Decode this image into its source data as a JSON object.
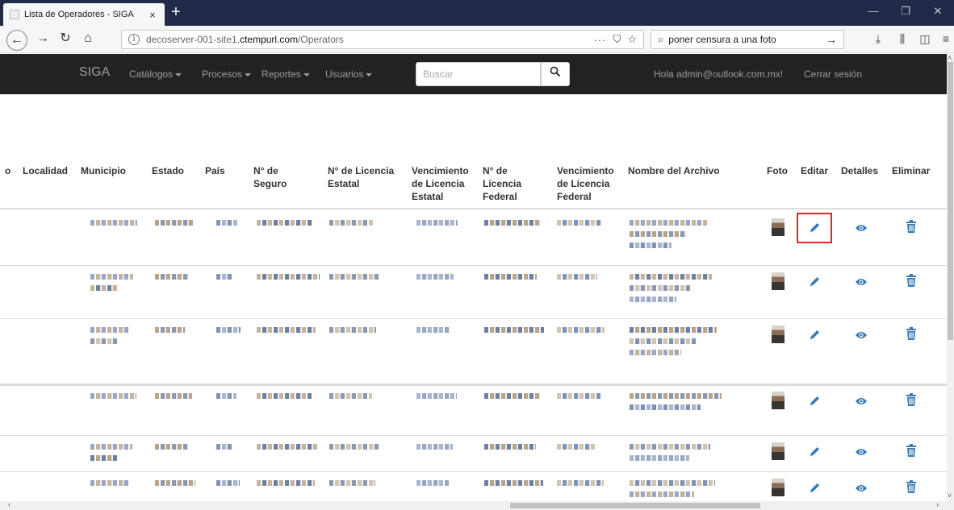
{
  "browser": {
    "tab_title": "Lista de Operadores - SIGA",
    "tab_close": "×",
    "new_tab": "+",
    "url_domain": "decoserver-001-site1.",
    "url_bold": "ctempurl.com",
    "url_path": "/Operators",
    "url_menu": "···",
    "search_query": "poner censura a una foto",
    "search_go": "→"
  },
  "site": {
    "brand": "SIGA",
    "menus": [
      "Catálogos",
      "Procesos",
      "Reportes",
      "Usuarios"
    ],
    "search_placeholder": "Buscar",
    "greeting": "Hola admin@outlook.com.mx!",
    "logout": "Cerrar sesión"
  },
  "table": {
    "headers": [
      "o",
      "Localidad",
      "Municipio",
      "Estado",
      "País",
      "N° de Seguro",
      "N° de Licencia Estatal",
      "Vencimiento de Licencia Estatal",
      "N° de Licencia Federal",
      "Vencimiento de Licencia Federal",
      "Nombre del Archivo",
      "Foto",
      "Editar",
      "Detalles",
      "Eliminar"
    ],
    "row_count": 6
  },
  "colors": {
    "header_bg": "#222222",
    "link_blue": "#337ab7",
    "highlight_red": "#d92b2b"
  },
  "icons": {
    "edit": "pencil-icon",
    "details": "eye-icon",
    "delete": "trash-icon"
  }
}
